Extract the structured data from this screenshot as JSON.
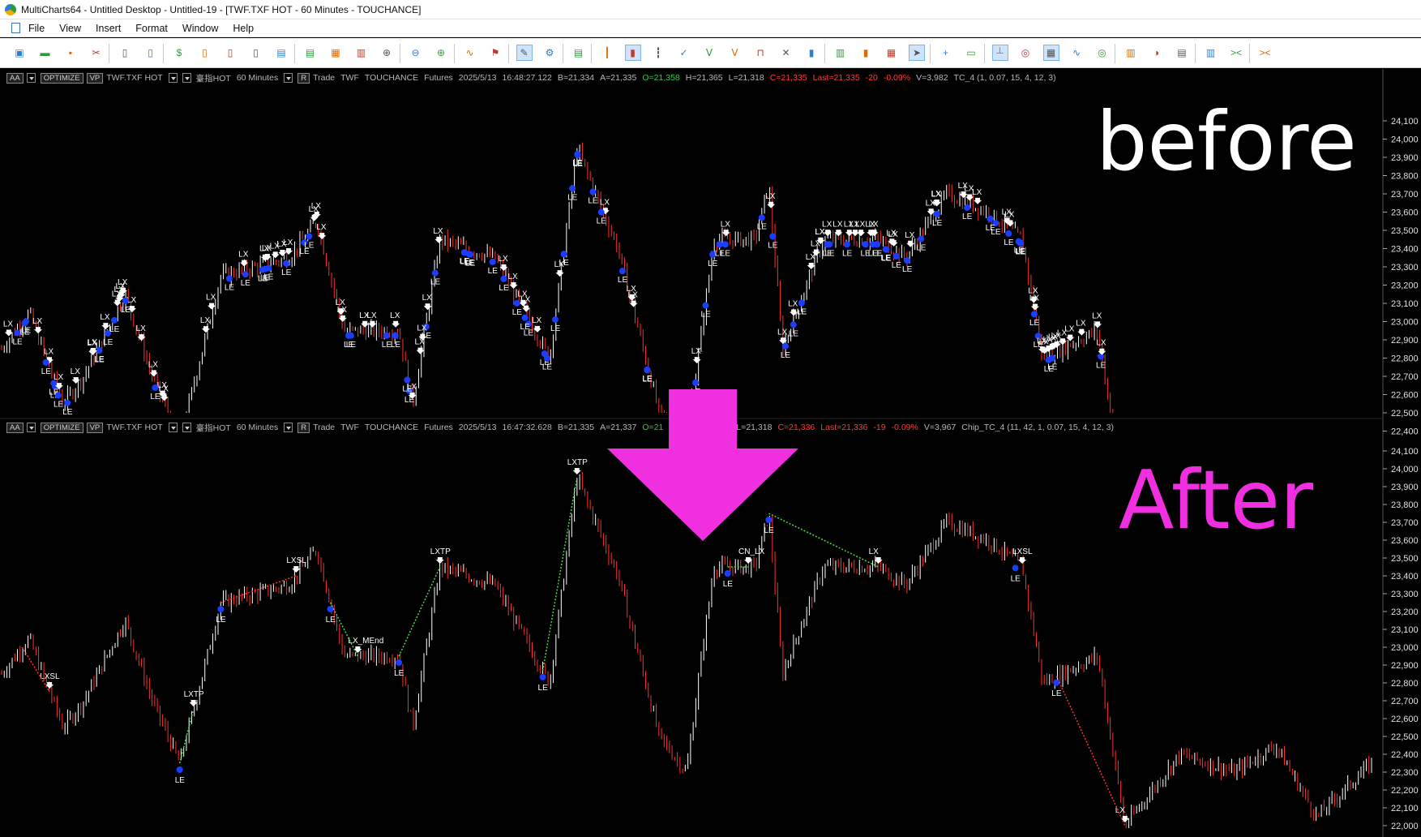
{
  "window": {
    "title": "MultiCharts64 - Untitled Desktop - Untitled-19 - [TWF.TXF HOT - 60 Minutes - TOUCHANCE]"
  },
  "menu": {
    "items": [
      "File",
      "View",
      "Insert",
      "Format",
      "Window",
      "Help"
    ]
  },
  "toolbar": {
    "icons": [
      "new-workspace-icon",
      "new-window-icon",
      "save-icon",
      "cut-icon",
      "document-icon",
      "document-icon",
      "currency-icon",
      "document-icon",
      "document-icon",
      "document-icon",
      "chart-insert-icon",
      "chart-insert-icon",
      "chart-add-icon",
      "quote-icon",
      "signal-add-icon",
      "signal-remove-icon",
      "indicator-add-icon",
      "study-icon",
      "alert-icon",
      "drawing-icon",
      "gear-icon",
      "dom-icon",
      "bar-ohlc-icon",
      "candle-icon",
      "bar-hlc-icon",
      "line-icon",
      "pointfigure-icon",
      "kagi-icon",
      "renko-icon",
      "cross-icon",
      "candle-hollow-icon",
      "histogram-icon",
      "volume-icon",
      "profile-icon",
      "pointer-icon",
      "crosshair-icon",
      "comment-icon",
      "hline-icon",
      "zoom-icon",
      "table-icon",
      "compare-icon",
      "link-icon",
      "vertical-icon",
      "trend-icon",
      "export-icon",
      "chart-icon",
      "fit-icon",
      "shrink-icon"
    ]
  },
  "pane_top": {
    "status": {
      "chips": [
        "AA",
        "OPTIMIZE",
        "VP"
      ],
      "symbol": "TWF.TXF HOT",
      "name": "臺指HOT",
      "interval": "60 Minutes",
      "mode": "R",
      "trade": "Trade",
      "exchange": "TWF",
      "feed": "TOUCHANCE",
      "category": "Futures",
      "datetime": "2025/5/13",
      "time": "16:48:27.122",
      "bid": "B=21,334",
      "ask": "A=21,335",
      "open": "O=21,358",
      "high": "H=21,365",
      "low": "L=21,318",
      "close": "C=21,335",
      "last": "Last=21,335",
      "chg": "-20",
      "pct": "-0.09%",
      "volume": "V=3,982",
      "study": "TC_4 (1, 0.07, 15, 4, 12, 3)"
    },
    "overlay": "before",
    "axis_labels": [
      "24,100",
      "24,000",
      "23,900",
      "23,800",
      "23,700",
      "23,600",
      "23,500",
      "23,400",
      "23,300",
      "23,200",
      "23,100",
      "23,000",
      "22,900",
      "22,800",
      "22,700",
      "22,600",
      "22,500",
      "22,400"
    ]
  },
  "pane_bottom": {
    "status": {
      "chips": [
        "AA",
        "OPTIMIZE",
        "VP"
      ],
      "symbol": "TWF.TXF HOT",
      "name": "臺指HOT",
      "interval": "60 Minutes",
      "mode": "R",
      "trade": "Trade",
      "exchange": "TWF",
      "feed": "TOUCHANCE",
      "category": "Futures",
      "datetime": "2025/5/13",
      "time": "16:47:32.628",
      "bid": "B=21,335",
      "ask": "A=21,337",
      "open": "O=21",
      "low": "L=21,318",
      "close": "C=21,336",
      "last": "Last=21,336",
      "chg": "-19",
      "pct": "-0.09%",
      "volume": "V=3,967",
      "study": "Chip_TC_4 (11, 42, 1, 0.07, 15, 4, 12, 3)"
    },
    "overlay": "After",
    "axis_labels": [
      "24,100",
      "24,000",
      "23,900",
      "23,800",
      "23,700",
      "23,600",
      "23,500",
      "23,400",
      "23,300",
      "23,200",
      "23,100",
      "23,000",
      "22,900",
      "22,800",
      "22,700",
      "22,600",
      "22,500",
      "22,400",
      "22,300",
      "22,200",
      "22,100",
      "22,000"
    ],
    "signals": [
      {
        "label": "LXTP",
        "pos": "peak"
      },
      {
        "label": "LXTP",
        "pos": "left"
      },
      {
        "label": "LXTP",
        "pos": "mid"
      },
      {
        "label": "LX_MEnd",
        "pos": "mid"
      },
      {
        "label": "LXSL",
        "pos": "left"
      },
      {
        "label": "LXSL",
        "pos": "mid"
      },
      {
        "label": "LXSL",
        "pos": "right"
      },
      {
        "label": "CN_LX",
        "pos": "mid"
      },
      {
        "label": "LX",
        "pos": "right"
      },
      {
        "label": "LE",
        "pos": "entry"
      }
    ]
  },
  "colors": {
    "accent_arrow": "#f030e0",
    "after_text": "#f030e0",
    "before_text": "#ffffff",
    "bull_candle": "#ffffff",
    "bear_candle": "#ff3030",
    "entry_dot": "#1a3dff",
    "trade_line_win": "#44dd44",
    "trade_line_loss": "#ff3030"
  }
}
